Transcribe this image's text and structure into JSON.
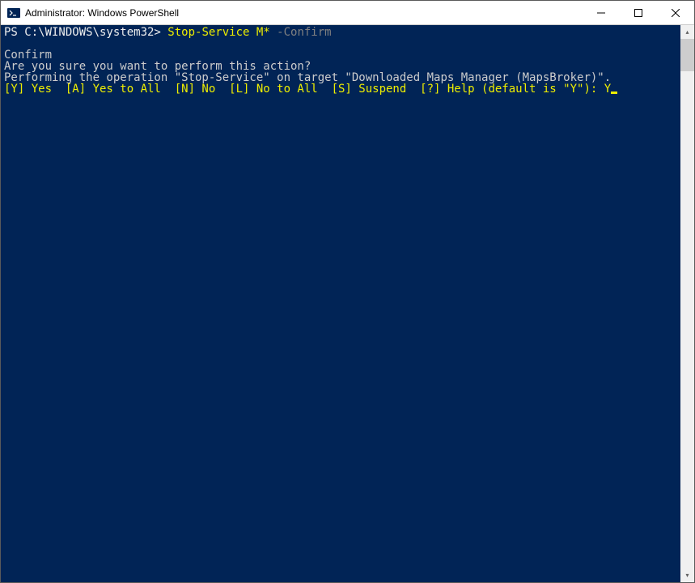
{
  "window": {
    "title": "Administrator: Windows PowerShell"
  },
  "prompt": {
    "prefix": "PS C:\\WINDOWS\\system32> ",
    "command": "Stop-Service M* ",
    "param": "-Confirm"
  },
  "output": {
    "blank1": " ",
    "confirm_header": "Confirm",
    "confirm_question": "Are you sure you want to perform this action?",
    "confirm_operation": "Performing the operation \"Stop-Service\" on target \"Downloaded Maps Manager (MapsBroker)\".",
    "choices": "[Y] Yes  [A] Yes to All  [N] No  [L] No to All  [S] Suspend  [?] Help (default is \"Y\"): ",
    "user_input": "Y"
  }
}
